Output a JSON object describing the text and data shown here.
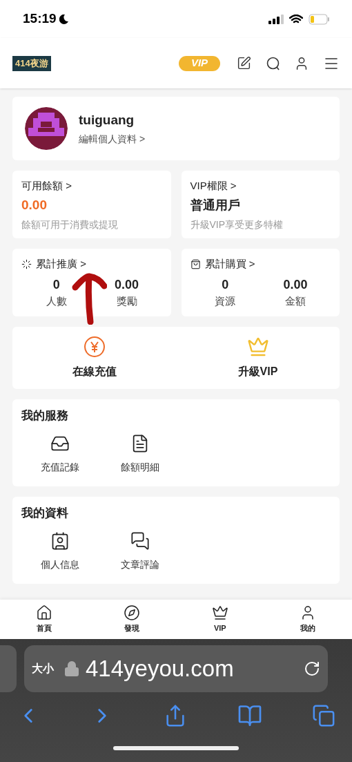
{
  "status_bar": {
    "time": "15:19"
  },
  "header": {
    "logo": "414夜游",
    "vip_badge": "VIP"
  },
  "profile": {
    "username": "tuiguang",
    "edit_link": "編輯個人資料 >"
  },
  "stat_cards": [
    {
      "kind": "balance",
      "title": "可用餘額 >",
      "value": "0.00",
      "note": "餘額可用于消費或提現"
    },
    {
      "kind": "balance",
      "title": "VIP權限 >",
      "value": "普通用戶",
      "note": "升級VIP享受更多特權"
    },
    {
      "kind": "pair",
      "title": "累計推廣 >",
      "items": [
        {
          "value": "0",
          "label": "人數"
        },
        {
          "value": "0.00",
          "label": "獎勵"
        }
      ]
    },
    {
      "kind": "pair",
      "title": "累計購買 >",
      "items": [
        {
          "value": "0",
          "label": "資源"
        },
        {
          "value": "0.00",
          "label": "金額"
        }
      ]
    }
  ],
  "actions": [
    "在線充值",
    "升級VIP"
  ],
  "sections": [
    {
      "title": "我的服務",
      "items": [
        "充值記錄",
        "餘額明細"
      ]
    },
    {
      "title": "我的資料",
      "items": [
        "個人信息",
        "文章評論"
      ]
    }
  ],
  "tab_bar": [
    "首頁",
    "發現",
    "VIP",
    "我的"
  ],
  "browser": {
    "text_size": "大小",
    "url": "414yeyou.com"
  }
}
